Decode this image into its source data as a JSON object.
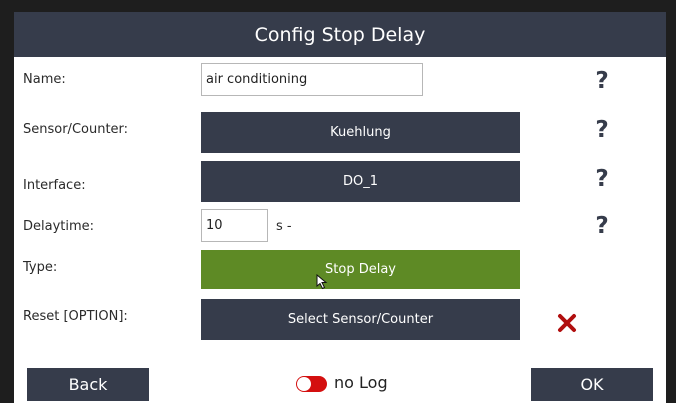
{
  "dialog": {
    "title": "Config Stop Delay"
  },
  "fields": {
    "name": {
      "label": "Name:",
      "value": "air conditioning"
    },
    "sensor": {
      "label": "Sensor/Counter:",
      "button": "Kuehlung"
    },
    "interface": {
      "label": "Interface:",
      "button": "DO_1"
    },
    "delay": {
      "label": "Delaytime:",
      "value": "10",
      "unit": "s -"
    },
    "type": {
      "label": "Type:",
      "button": "Stop Delay"
    },
    "reset": {
      "label": "Reset [OPTION]:",
      "button": "Select Sensor/Counter"
    }
  },
  "help_symbol": "?",
  "footer": {
    "back": "Back",
    "ok": "OK",
    "log_toggle": "no Log"
  },
  "colors": {
    "header": "#363c4b",
    "button": "#363c4b",
    "type_button": "#5e8a25",
    "toggle": "#d40f0f",
    "clear_icon": "#b10e0e"
  },
  "icons": {
    "help": "question-mark-icon",
    "clear": "x-mark-icon",
    "cursor": "mouse-pointer-icon"
  }
}
